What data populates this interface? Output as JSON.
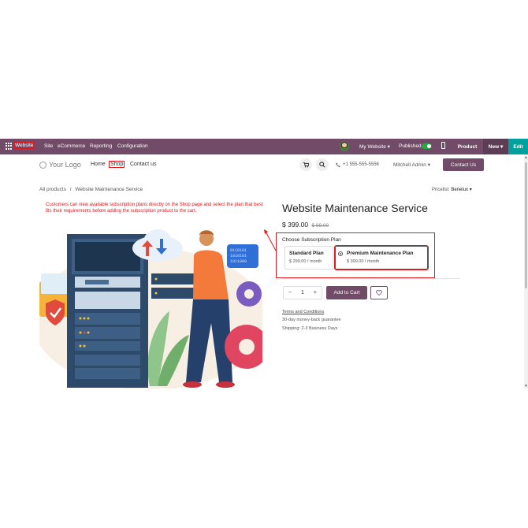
{
  "topbar": {
    "app_name": "Website",
    "menus": [
      "Site",
      "eCommerce",
      "Reporting",
      "Configuration"
    ],
    "website_selector": "My Website ▾",
    "published_label": "Published",
    "product_label": "Product",
    "new_label": "New ▾",
    "edit_label": "Edit"
  },
  "header": {
    "logo": "Your Logo",
    "nav": {
      "home": "Home",
      "shop": "Shop",
      "contact": "Contact us"
    },
    "phone": "+1 555-555-5556",
    "admin": "Mitchell Admin ▾",
    "contact_button": "Contact Us"
  },
  "breadcrumb": {
    "root": "All products",
    "separator": "/",
    "current": "Website Maintenance Service"
  },
  "pricelist": {
    "label": "Pricelist:",
    "value": "Benelux ▾"
  },
  "annotation_note": "Customers can view available subscription plans directly on the Shop page and select the plan that best fits their requirements before adding the subscription product to the cart.",
  "product": {
    "title": "Website Maintenance Service",
    "price": "$ 399.00",
    "old_price": "$ 99.00",
    "plan_heading": "Choose Subscription Plan",
    "plans": [
      {
        "name": "Standard Plan",
        "price": "$ 299.00 / month"
      },
      {
        "name": "Premium Maintenance Plan",
        "price": "$ 399.00 / month"
      }
    ],
    "quantity": "1",
    "minus": "−",
    "plus": "+",
    "add_to_cart": "Add to Cart",
    "terms": "Terms and Conditions",
    "guarantee": "30-day money-back guarantee",
    "shipping": "Shipping: 2-3 Business Days"
  },
  "illustration": {
    "binary": [
      "0110101",
      "1010101",
      "1011000"
    ]
  },
  "colors": {
    "brand": "#714b67",
    "edit": "#00a09d",
    "highlight": "#e0171d",
    "published": "#28a745"
  }
}
